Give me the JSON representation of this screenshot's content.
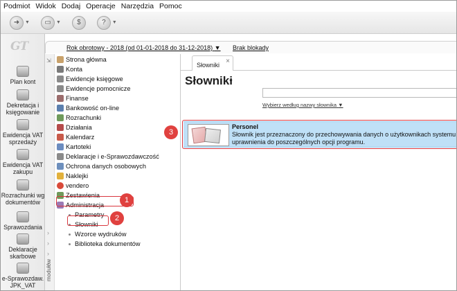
{
  "menu": [
    "Podmiot",
    "Widok",
    "Dodaj",
    "Operacje",
    "Narzędzia",
    "Pomoc"
  ],
  "toolbar": {
    "buttons": [
      {
        "name": "back-button",
        "icon": "back-icon",
        "has_dropdown": true
      },
      {
        "name": "forward-button",
        "icon": "forward-icon",
        "has_dropdown": true
      },
      {
        "name": "currency-button",
        "icon": "dollar-icon",
        "has_dropdown": false
      },
      {
        "name": "help-button",
        "icon": "question-icon",
        "has_dropdown": true
      }
    ]
  },
  "app": {
    "logo": "GT"
  },
  "modules": [
    {
      "label": "Plan kont",
      "icon": "coins-icon"
    },
    {
      "label": "Dekretacja i księgowanie",
      "icon": "ledger-icon"
    },
    {
      "label": "Ewidencja VAT sprzedaży",
      "icon": "invoice-icon"
    },
    {
      "label": "Ewidencja VAT zakupu",
      "icon": "invoice-icon"
    },
    {
      "label": "Rozrachunki wg dokumentów",
      "icon": "checkmark-icon"
    },
    {
      "label": "Sprawozdania",
      "icon": "report-icon"
    },
    {
      "label": "Deklaracje skarbowe",
      "icon": "declaration-icon"
    },
    {
      "label": "e-Sprawozdaw. JPK_VAT",
      "icon": "jpk-icon"
    }
  ],
  "period": {
    "label": "Rok obrotowy - 2018  (od 01-01-2018 do 31-12-2018)",
    "lock_status": "Brak blokady"
  },
  "nav_strip_label": "modułów",
  "nav": {
    "items": [
      {
        "label": "Strona główna",
        "icon": "home-icon",
        "color": "#c9a26b"
      },
      {
        "label": "Konta",
        "icon": "accounts-icon",
        "color": "#7a7a7a"
      },
      {
        "label": "Ewidencje księgowe",
        "icon": "ledger-icon",
        "color": "#8a8a8a"
      },
      {
        "label": "Ewidencje pomocnicze",
        "icon": "ledger-icon",
        "color": "#8a8a8a"
      },
      {
        "label": "Finanse",
        "icon": "finance-icon",
        "color": "#9b6c6c"
      },
      {
        "label": "Bankowość on-line",
        "icon": "bank-icon",
        "color": "#5b7fae"
      },
      {
        "label": "Rozrachunki",
        "icon": "checkmark-icon",
        "color": "#6f9a5b"
      },
      {
        "label": "Działania",
        "icon": "actions-icon",
        "color": "#b54b4b"
      },
      {
        "label": "Kalendarz",
        "icon": "calendar-icon",
        "color": "#c85a4a"
      },
      {
        "label": "Kartoteki",
        "icon": "cards-icon",
        "color": "#6b8cc0"
      },
      {
        "label": "Deklaracje i e-Sprawozdawczość",
        "icon": "declaration-icon",
        "color": "#8a8a8a"
      },
      {
        "label": "Ochrona danych osobowych",
        "icon": "shield-icon",
        "color": "#6d8fbd"
      },
      {
        "label": "Naklejki",
        "icon": "sticker-icon",
        "color": "#e2b13c"
      },
      {
        "label": "vendero",
        "icon": "vendero-icon",
        "color": "#d94a3a"
      },
      {
        "label": "Zestawienia",
        "icon": "chart-icon",
        "color": "#6f9a5b"
      },
      {
        "label": "Administracja",
        "icon": "admin-icon",
        "color": "#9b7bb5"
      }
    ],
    "subitems": [
      "Parametry",
      "Słowniki",
      "Wzorce wydruków",
      "Biblioteka dokumentów"
    ]
  },
  "annotations": [
    "1",
    "2",
    "3"
  ],
  "tab": {
    "label": "Słowniki",
    "close": "×"
  },
  "main": {
    "title": "Słowniki",
    "search_placeholder": "",
    "search_hint": "Wybierz według nazwy słownika"
  },
  "dictionaries": [
    {
      "name": "Personel",
      "description": "Słownik jest przeznaczony do przechowywania danych o użytkownikach systemu uprawnienia do poszczególnych opcji programu."
    }
  ],
  "colors": {
    "highlight": "#d9363e",
    "badge": "#e0413f",
    "selected_row": "#bfe0f7"
  }
}
